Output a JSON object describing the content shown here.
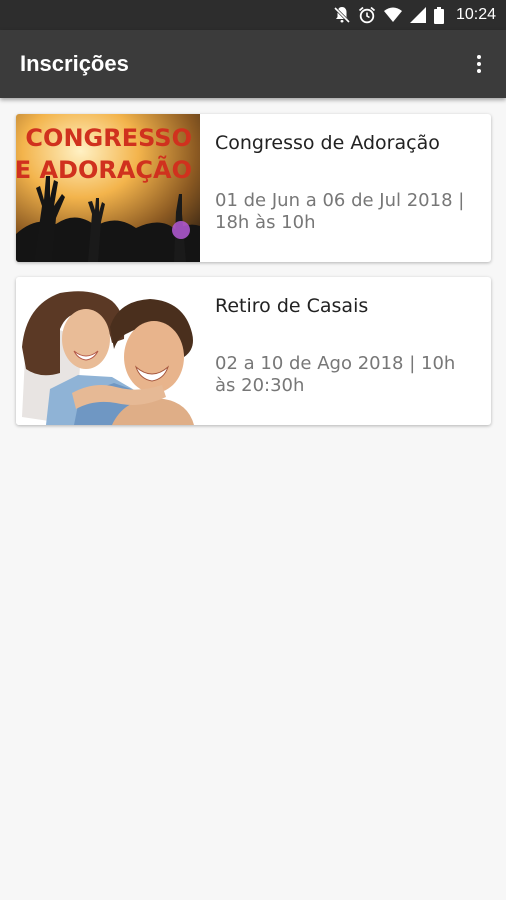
{
  "status_bar": {
    "time": "10:24",
    "icons": [
      "notifications-off-icon",
      "alarm-icon",
      "wifi-icon",
      "signal-icon",
      "battery-icon"
    ]
  },
  "app_bar": {
    "title": "Inscrições",
    "menu_icon": "more-vertical-icon"
  },
  "events": [
    {
      "title": "Congresso de Adoração",
      "date": "01 de Jun a 06 de Jul 2018 | 18h às 10h",
      "image_text_line1": "CONGRESSO",
      "image_text_line2": "DE ADORAÇÃO"
    },
    {
      "title": "Retiro de Casais",
      "date": "02 a 10 de Ago 2018 | 10h às 20:30h"
    }
  ],
  "colors": {
    "status_bar": "#2d2d2d",
    "app_bar": "#3b3b3b",
    "background": "#f7f7f7",
    "card": "#ffffff"
  }
}
